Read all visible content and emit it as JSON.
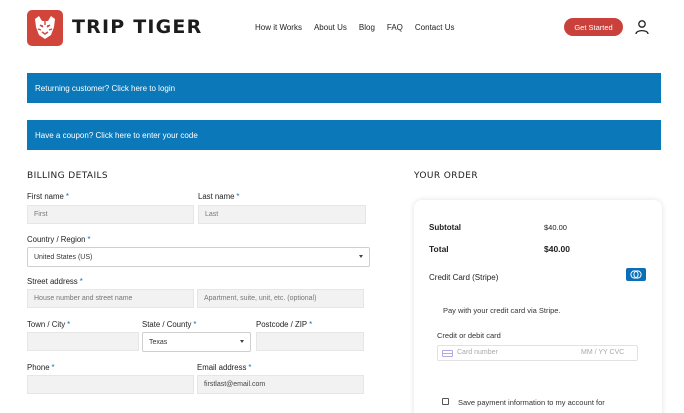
{
  "header": {
    "brand": "TRIP TIGER",
    "nav": [
      "How it Works",
      "About Us",
      "Blog",
      "FAQ",
      "Contact Us"
    ],
    "cta_label": "Get Started",
    "icons": {
      "logo": "tiger-logo-icon",
      "account": "user-icon"
    }
  },
  "notices": {
    "login": "Returning customer? Click here to login",
    "coupon": "Have a coupon? Click here to enter your code"
  },
  "billing": {
    "title": "BILLING DETAILS",
    "required_mark": "*",
    "first_name": {
      "label": "First name",
      "placeholder": "First"
    },
    "last_name": {
      "label": "Last name",
      "placeholder": "Last"
    },
    "country": {
      "label": "Country / Region",
      "value": "United States (US)"
    },
    "street": {
      "label": "Street address",
      "placeholder1": "House number and street name",
      "placeholder2": "Apartment, suite, unit, etc. (optional)"
    },
    "city": {
      "label": "Town / City"
    },
    "state": {
      "label": "State / County",
      "value": "Texas"
    },
    "postcode": {
      "label": "Postcode / ZIP"
    },
    "phone": {
      "label": "Phone"
    },
    "email": {
      "label": "Email address",
      "value": "firstlast@email.com"
    }
  },
  "order": {
    "title": "YOUR ORDER",
    "subtotal_label": "Subtotal",
    "subtotal_value": "$40.00",
    "total_label": "Total",
    "total_value": "$40.00",
    "payment_method": "Credit Card (Stripe)",
    "payment_desc": "Pay with your credit card via Stripe.",
    "card_label": "Credit or debit card",
    "card_number_placeholder": "Card number",
    "card_expiry_cvc_placeholder": "MM / YY  CVC",
    "save_label": "Save payment information to my account for"
  },
  "colors": {
    "accent_blue": "#0b78b9",
    "brand_red": "#c9413a"
  }
}
